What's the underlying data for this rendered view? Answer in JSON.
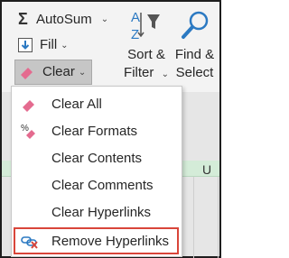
{
  "ribbon": {
    "autosum_label": "AutoSum",
    "fill_label": "Fill",
    "clear_label": "Clear",
    "sort_filter_label_1": "Sort &",
    "sort_filter_label_2": "Filter",
    "find_select_label_1": "Find &",
    "find_select_label_2": "Select"
  },
  "sheet": {
    "column_label": "U"
  },
  "menu": {
    "items": [
      {
        "label": "Clear All",
        "icon": "eraser-icon"
      },
      {
        "label": "Clear Formats",
        "icon": "percent-eraser-icon"
      },
      {
        "label": "Clear Contents",
        "icon": ""
      },
      {
        "label": "Clear Comments",
        "icon": ""
      },
      {
        "label": "Clear Hyperlinks",
        "icon": ""
      },
      {
        "label": "Remove Hyperlinks",
        "icon": "unlink-icon"
      }
    ]
  },
  "colors": {
    "highlight_border": "#d9453a",
    "accent_blue": "#2b79c2",
    "eraser_pink": "#e46b8f"
  }
}
